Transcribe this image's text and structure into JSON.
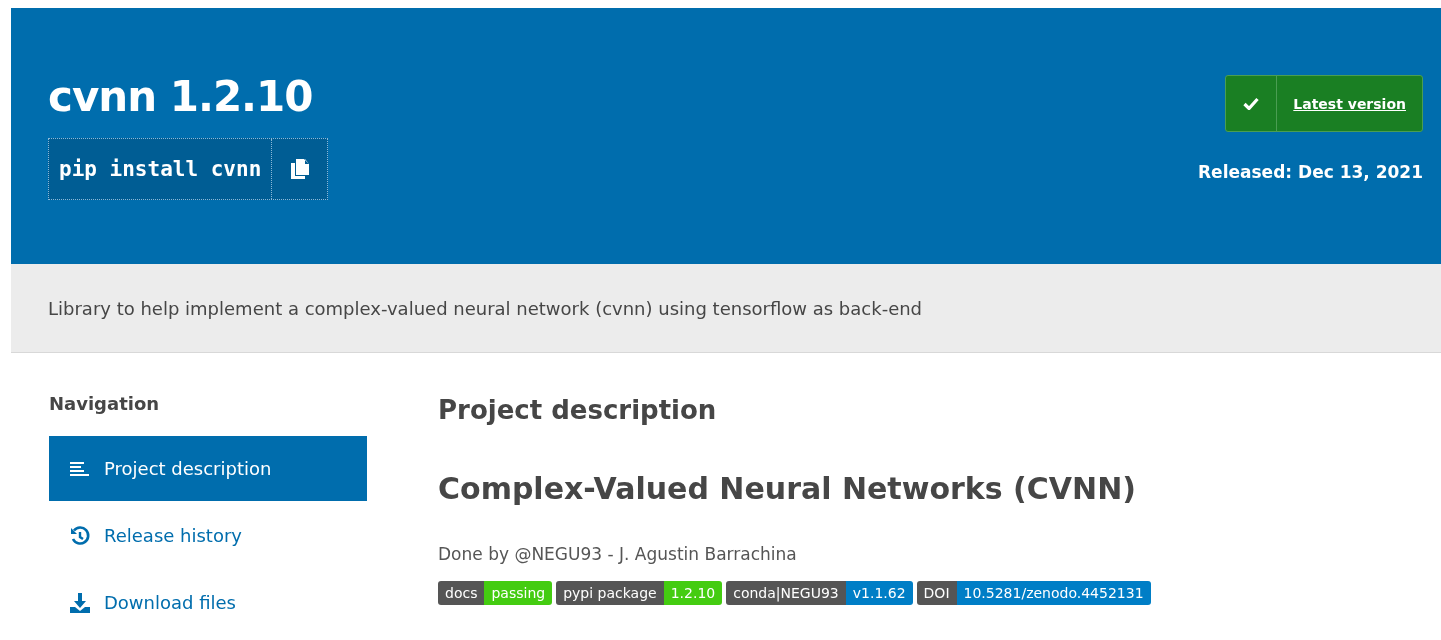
{
  "header": {
    "title": "cvnn 1.2.10",
    "install_command": "pip install cvnn",
    "latest_button": "Latest version",
    "released": "Released: Dec 13, 2021"
  },
  "summary": "Library to help implement a complex-valued neural network (cvnn) using tensorflow as back-end",
  "sidebar": {
    "heading": "Navigation",
    "items": [
      {
        "label": "Project description",
        "kind": "description",
        "selected": true
      },
      {
        "label": "Release history",
        "kind": "history",
        "selected": false
      },
      {
        "label": "Download files",
        "kind": "download",
        "selected": false
      }
    ]
  },
  "main": {
    "heading": "Project description",
    "title": "Complex-Valued Neural Networks (CVNN)",
    "byline": "Done by @NEGU93 - J. Agustin Barrachina",
    "badges": [
      {
        "label": "docs",
        "value": "passing",
        "color": "#44cc11"
      },
      {
        "label": "pypi package",
        "value": "1.2.10",
        "color": "#44cc11"
      },
      {
        "label": "conda|NEGU93",
        "value": "v1.1.62",
        "color": "#007ec6"
      },
      {
        "label": "DOI",
        "value": "10.5281/zenodo.4452131",
        "color": "#007ec6"
      }
    ]
  }
}
